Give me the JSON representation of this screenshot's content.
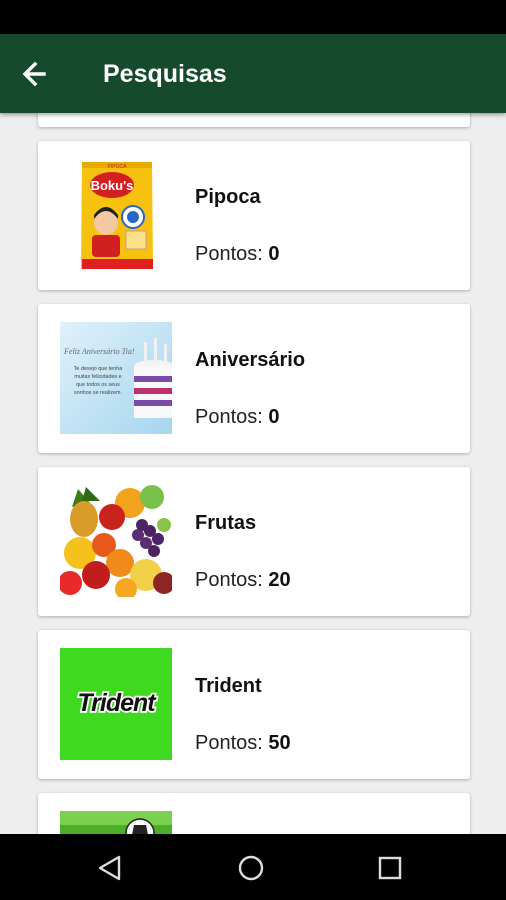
{
  "app_bar": {
    "title": "Pesquisas",
    "back_icon": "arrow-left-icon"
  },
  "items": [
    {
      "title": "Pipoca",
      "points_label": "Pontos: ",
      "points": "0",
      "image": {
        "icon": "popcorn-bag-image",
        "brand_text": "Boku's",
        "top_text": "PIPOCA"
      }
    },
    {
      "title": "Aniversário",
      "points_label": "Pontos: ",
      "points": "0",
      "image": {
        "icon": "birthday-card-image",
        "card_title": "Feliz Aniversário Tia!",
        "card_lines": [
          "Te desejo que tenha",
          "muitas felicidades e",
          "que todos os seus",
          "sonhos se realizem."
        ]
      }
    },
    {
      "title": "Frutas",
      "points_label": "Pontos: ",
      "points": "20",
      "image": {
        "icon": "fruits-image"
      }
    },
    {
      "title": "Trident",
      "points_label": "Pontos: ",
      "points": "50",
      "image": {
        "icon": "trident-logo-image",
        "brand_text": "Trident"
      }
    }
  ],
  "nav": {
    "back": "triangle-back-icon",
    "home": "circle-home-icon",
    "recents": "square-recents-icon"
  },
  "colors": {
    "app_bar": "#154a2c",
    "trident_green": "#3fda20",
    "background": "#eeeeee"
  }
}
